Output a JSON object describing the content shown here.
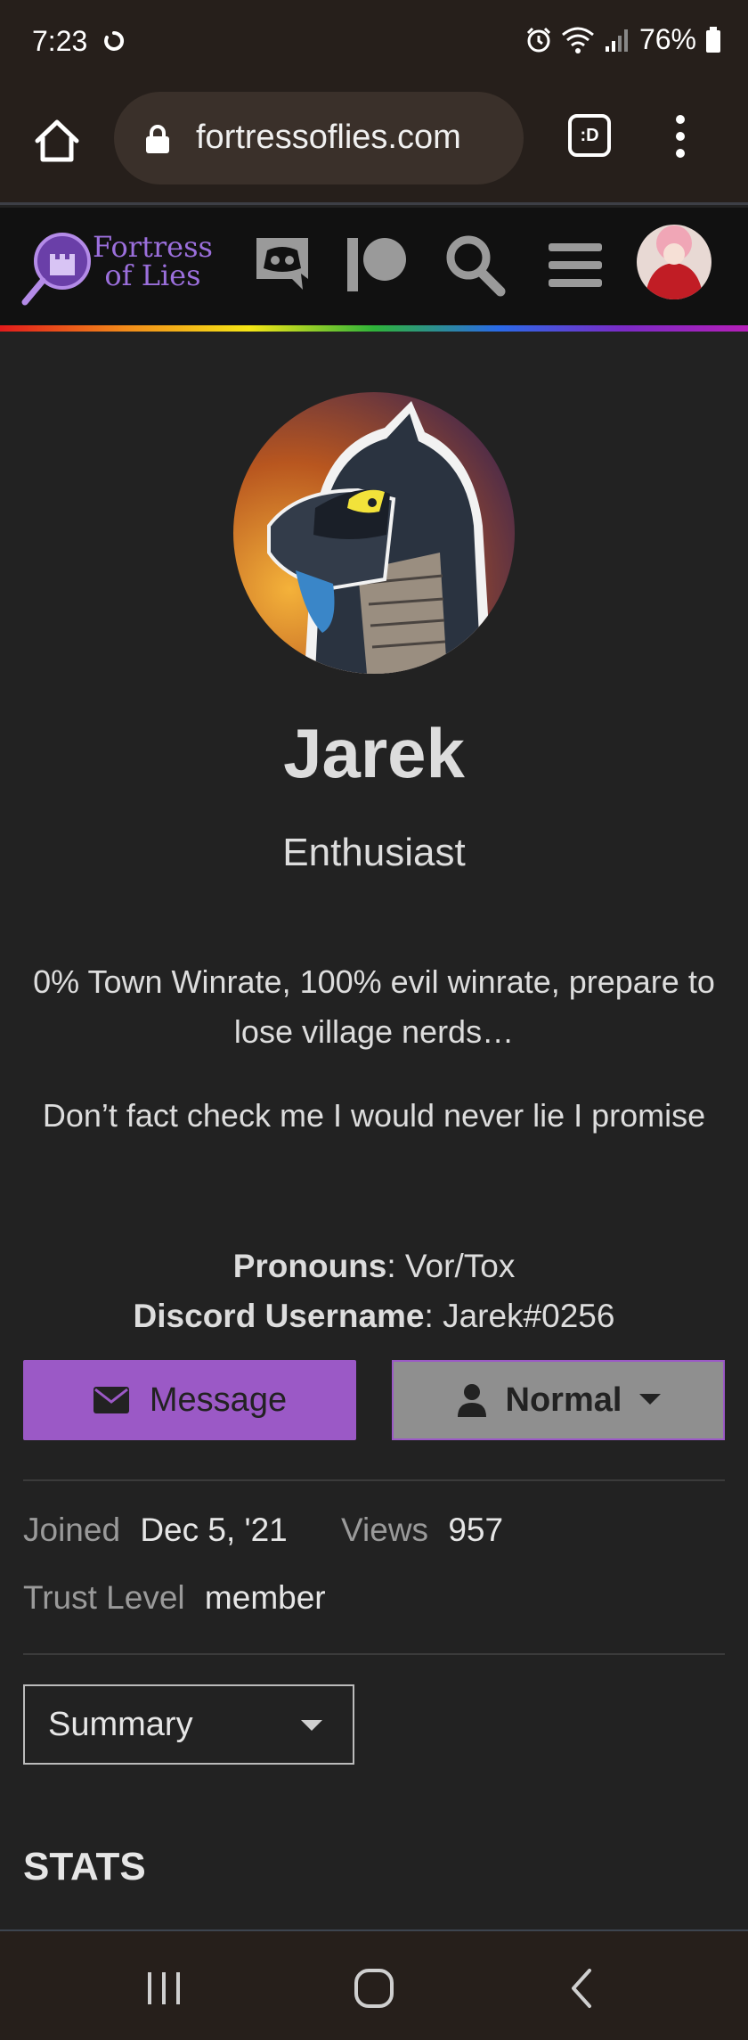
{
  "status_bar": {
    "time": "7:23",
    "battery": "76%"
  },
  "browser": {
    "url": "fortressoflies.com",
    "tabs_label": ":D"
  },
  "site": {
    "logo_line1": "Fortress",
    "logo_line2": "of Lies"
  },
  "profile": {
    "username": "Jarek",
    "title": "Enthusiast",
    "bio_paragraph_1": "0% Town Winrate, 100% evil winrate, prepare to lose village nerds…",
    "bio_paragraph_2": "Don’t fact check me I would never lie I promise",
    "fields": [
      {
        "label": "Pronouns",
        "value": ": Vor/Tox"
      },
      {
        "label": "Discord Username",
        "value": ": Jarek#0256"
      }
    ],
    "message_label": "Message",
    "notification_label": "Normal",
    "joined_label": "Joined",
    "joined_value": "Dec 5, '21",
    "views_label": "Views",
    "views_value": "957",
    "trust_label": "Trust Level",
    "trust_value": "member",
    "summary_select": "Summary",
    "stats_heading": "STATS"
  },
  "colors": {
    "accent": "#9b59c6",
    "background": "#222222",
    "logo": "#9b6fdc"
  },
  "icons": [
    "home-icon",
    "lock-icon",
    "discord-icon",
    "patreon-icon",
    "search-icon",
    "hamburger-icon",
    "envelope-icon",
    "user-icon",
    "chevron-down-icon"
  ]
}
